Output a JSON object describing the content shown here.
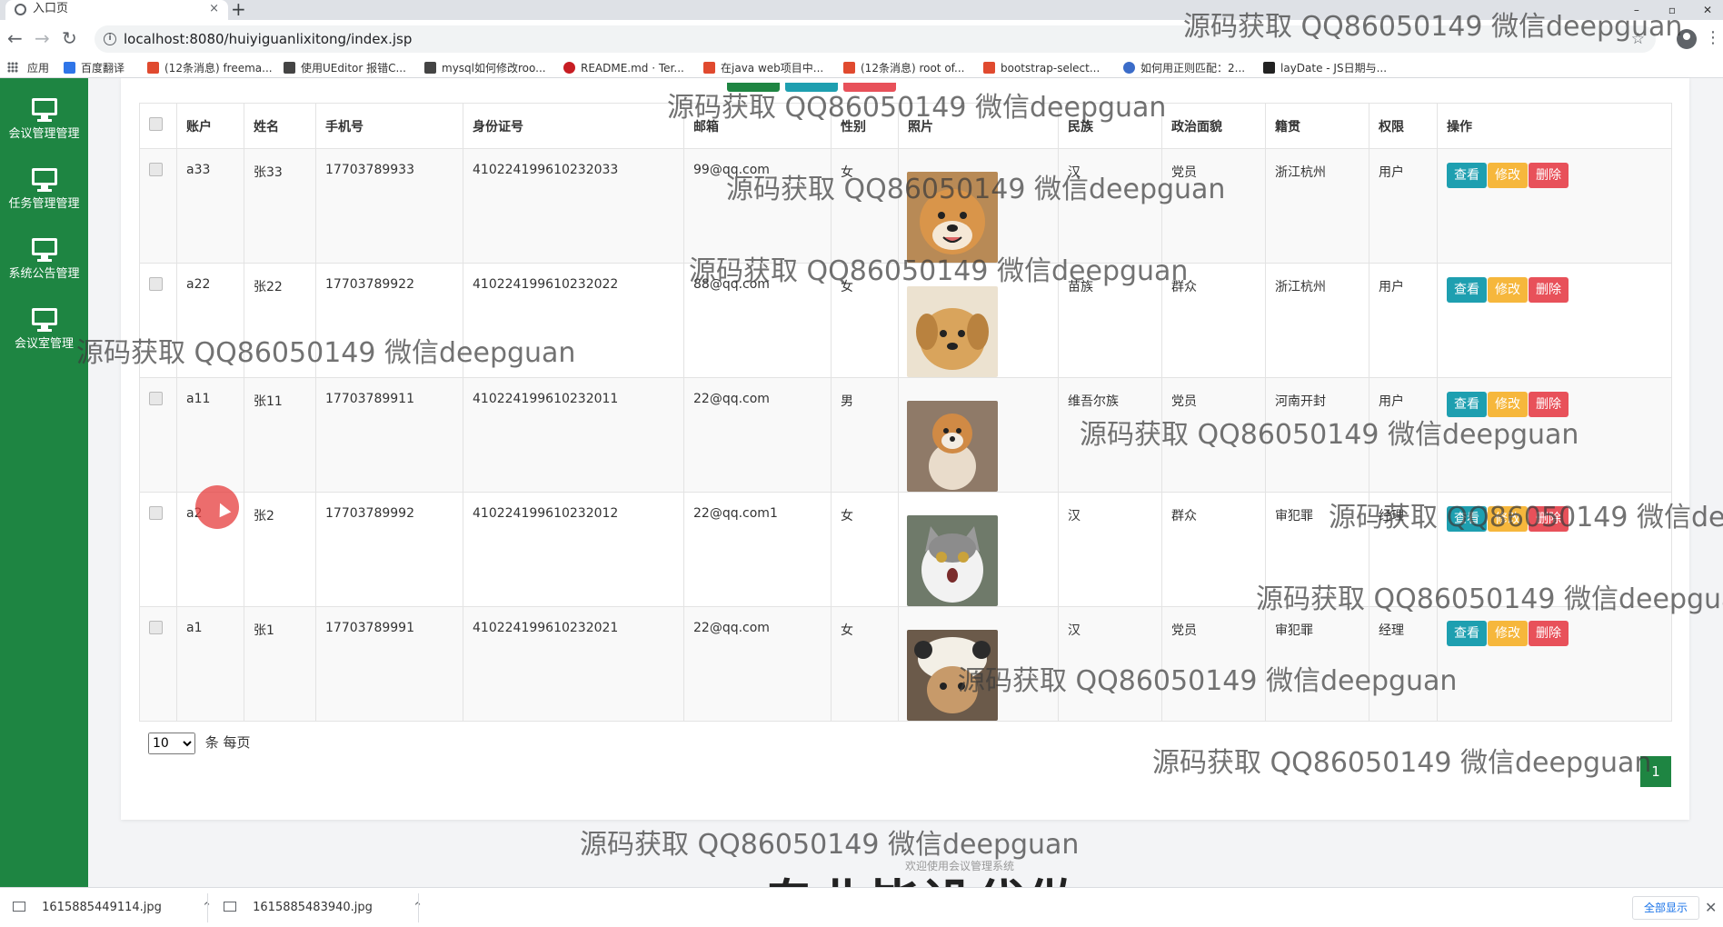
{
  "browser": {
    "tab_title": "入口页",
    "tab_close": "×",
    "new_tab": "+",
    "url": "localhost:8080/huiyiguanlixitong/index.jsp",
    "window_controls": [
      "–",
      "▫",
      "✕"
    ],
    "bookmarks": [
      {
        "label": "应用",
        "icon_color": "#5f6368"
      },
      {
        "label": "百度翻译",
        "icon_color": "#2f75e8"
      },
      {
        "label": "(12条消息) freema...",
        "icon_color": "#e04a2f"
      },
      {
        "label": "使用UEditor 报错C...",
        "icon_color": "#444444"
      },
      {
        "label": "mysql如何修改roo...",
        "icon_color": "#444444"
      },
      {
        "label": "README.md · Ter...",
        "icon_color": "#c71d23"
      },
      {
        "label": "在java web项目中...",
        "icon_color": "#e04a2f"
      },
      {
        "label": "(12条消息) root of...",
        "icon_color": "#e04a2f"
      },
      {
        "label": "bootstrap-select...",
        "icon_color": "#e04a2f"
      },
      {
        "label": "如何用正则匹配：2...",
        "icon_color": "#3b6cc9"
      },
      {
        "label": "layDate - JS日期与...",
        "icon_color": "#222222"
      }
    ]
  },
  "sidebar": {
    "items": [
      {
        "label": "会议管理管理"
      },
      {
        "label": "任务管理管理"
      },
      {
        "label": "系统公告管理"
      },
      {
        "label": "会议室管理"
      }
    ]
  },
  "table": {
    "columns": [
      "账户",
      "姓名",
      "手机号",
      "身份证号",
      "邮箱",
      "性别",
      "照片",
      "民族",
      "政治面貌",
      "籍贯",
      "权限",
      "操作"
    ],
    "rows": [
      {
        "account": "a33",
        "name": "张33",
        "phone": "17703789933",
        "id_number": "410224199610232033",
        "email": "99@qq.com",
        "gender": "女",
        "photo": "shiba-smiling",
        "ethnicity": "汉",
        "political": "党员",
        "hometown": "浙江杭州",
        "role": "用户"
      },
      {
        "account": "a22",
        "name": "张22",
        "phone": "17703789922",
        "id_number": "410224199610232022",
        "email": "88@qq.com",
        "gender": "女",
        "photo": "golden-puppy",
        "ethnicity": "苗族",
        "political": "群众",
        "hometown": "浙江杭州",
        "role": "用户"
      },
      {
        "account": "a11",
        "name": "张11",
        "phone": "17703789911",
        "id_number": "410224199610232011",
        "email": "22@qq.com",
        "gender": "男",
        "photo": "shiba-sitting",
        "ethnicity": "维吾尔族",
        "political": "党员",
        "hometown": "河南开封",
        "role": "用户"
      },
      {
        "account": "a2",
        "name": "张2",
        "phone": "17703789992",
        "id_number": "410224199610232012",
        "email": "22@qq.com1",
        "gender": "女",
        "photo": "grey-cat",
        "ethnicity": "汉",
        "political": "群众",
        "hometown": "审犯罪",
        "role": "经理"
      },
      {
        "account": "a1",
        "name": "张1",
        "phone": "17703789991",
        "id_number": "410224199610232021",
        "email": "22@qq.com",
        "gender": "女",
        "photo": "cat-in-hat",
        "ethnicity": "汉",
        "political": "党员",
        "hometown": "审犯罪",
        "role": "经理"
      }
    ],
    "actions": {
      "view": "查看",
      "edit": "修改",
      "delete": "删除"
    }
  },
  "pagination": {
    "per_page_value": "10",
    "per_page_suffix": "条 每页",
    "current_page": "1"
  },
  "footer": {
    "text": "欢迎使用会议管理系统"
  },
  "watermarks": {
    "text": "源码获取 QQ86050149 微信deepguan",
    "partial": "源码获取 QQ86050149 微信dee",
    "partial2": "源码获取 QQ86050149 微信deepgua"
  },
  "banner": "专业毕设代做",
  "downloads": {
    "items": [
      {
        "name": "1615885449114.jpg"
      },
      {
        "name": "1615885483940.jpg"
      }
    ],
    "show_all": "全部显示",
    "close": "✕"
  },
  "colors": {
    "sidebar": "#1e8542",
    "view_button": "#1e9fb0",
    "edit_button": "#f6b73c",
    "delete_button": "#e8515a",
    "page_active": "#1e8542"
  }
}
